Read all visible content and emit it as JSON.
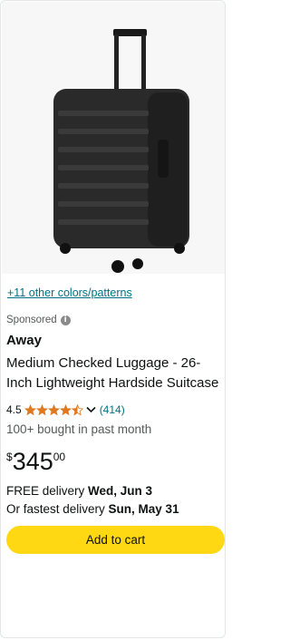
{
  "product": {
    "colors_link": "+11 other colors/patterns",
    "sponsored_label": "Sponsored",
    "brand": "Away",
    "title": "Medium Checked Luggage - 26-Inch Lightweight Hardside Suitcase",
    "rating_value": "4.5",
    "rating_stars": 4.5,
    "review_count": "(414)",
    "bought_text": "100+ bought in past month",
    "price": {
      "symbol": "$",
      "whole": "345",
      "fraction": "00"
    },
    "delivery": {
      "free_prefix": "FREE delivery ",
      "free_date": "Wed, Jun 3",
      "fastest_prefix": "Or fastest delivery ",
      "fastest_date": "Sun, May 31"
    },
    "add_to_cart_label": "Add to cart"
  },
  "colors": {
    "link": "#007185",
    "star": "#DE7921",
    "button": "#FFD814"
  },
  "icons": [
    "info-icon",
    "star-icon",
    "chevron-down-icon",
    "suitcase-image"
  ]
}
